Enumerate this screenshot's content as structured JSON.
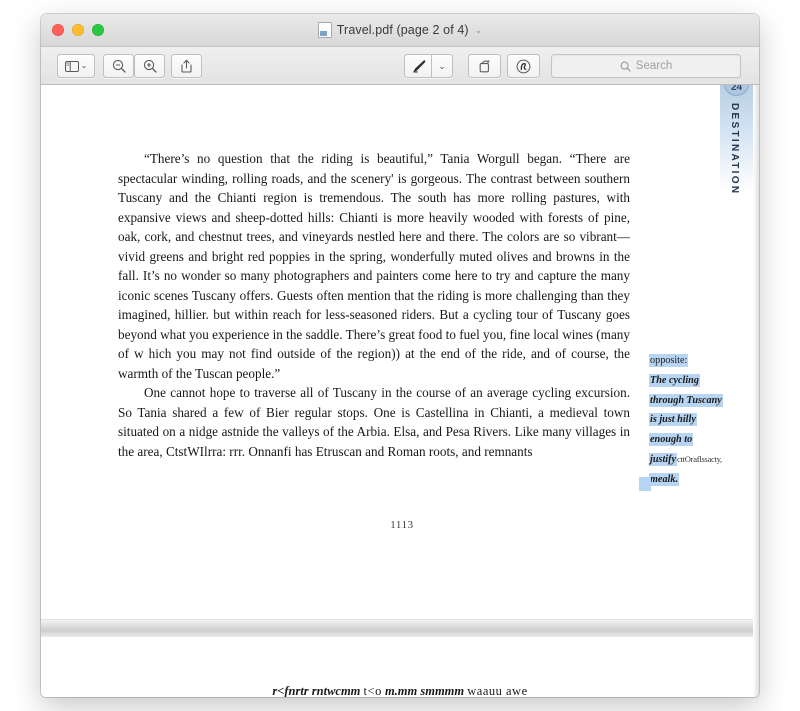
{
  "window": {
    "title": "Travel.pdf (page 2 of 4)",
    "title_chevron": "⌄",
    "doc_icon": "pdf-document-icon"
  },
  "traffic_lights": {
    "close": "close-window-button",
    "minimize": "minimize-window-button",
    "maximize": "maximize-window-button",
    "colors": {
      "close": "#fe5f57",
      "minimize": "#febc2e",
      "maximize": "#28c840"
    }
  },
  "toolbar": {
    "sidebar_label": "sidebar-toggle",
    "sidebar_caret": "⌄",
    "zoom_out_label": "zoom-out",
    "zoom_in_label": "zoom-in",
    "share_label": "share",
    "markup_label": "markup",
    "markup_caret": "⌄",
    "rotate_label": "rotate",
    "sign_label": "sign",
    "search_placeholder": "Search",
    "search_value": ""
  },
  "document": {
    "running_header": "....",
    "paragraphs": [
      "“There’s no question that the riding is beautiful,” Tania Worgull began. “There are spectacular winding, rolling roads, and the scenery' is gorgeous. The contrast between southern Tuscany and the Chianti region is tremendous. The south has more rolling pastures, with expansive views and sheep-dotted hills: Chianti is more heavily wooded with forests of pine, oak, cork, and chestnut trees, and vineyards nestled here and there. The colors are so vibrant—vivid greens and bright red poppies in the spring, wonderfully muted olives and browns in the fall. It’s no wonder so many photographers and painters come here to try and capture the many iconic scenes Tuscany offers. Guests often mention that the riding is more challenging than they imagined, hillier. but within reach for less-seasoned riders. But a cycling tour of Tuscany goes beyond what you experience in the saddle. There’s great food to fuel you, fine local wines (many of w hich you may not find outside of the region)) at the end of the ride, and of course, the warmth of the Tuscan people.”",
      "One cannot hope to traverse all of Tuscany in the course of an average cycling excursion. So Tania shared a few of Bier regular stops. One is Castellina in Chianti, a medieval town situated on a nidge astnide the valleys of the Arbia. Elsa, and Pesa Rivers. Like many villages in the area, CtstWIlrra: rrr. Onnanfi has Etruscan and Roman roots, and remnants"
    ],
    "page_number": "1113",
    "side_caption": {
      "lines": [
        {
          "text": "opposite:",
          "style": "plain",
          "highlight": true
        },
        {
          "text": "The cycling",
          "style": "italic",
          "highlight": true
        },
        {
          "text": "through Tuscany",
          "style": "italic",
          "highlight": true
        },
        {
          "text": "is just hilly",
          "style": "italic",
          "highlight": true
        },
        {
          "text": "enough to",
          "style": "italic",
          "highlight": true
        },
        {
          "text": "justify",
          "style": "italic",
          "highlight": true,
          "trailing": "cttOraflssacty,"
        },
        {
          "text": "mealk.",
          "style": "italic",
          "highlight": true
        }
      ],
      "highlight_color": "#b7d4f2"
    },
    "destination_tab": {
      "number": "24",
      "label": "DESTINATION"
    },
    "next_page_text": {
      "bold_italic_1": "r<fnrtr rntwcmm",
      "regular_1": "t<o",
      "bold_italic_2": "m.mm smmmm",
      "regular_2": "waauu awe"
    }
  }
}
